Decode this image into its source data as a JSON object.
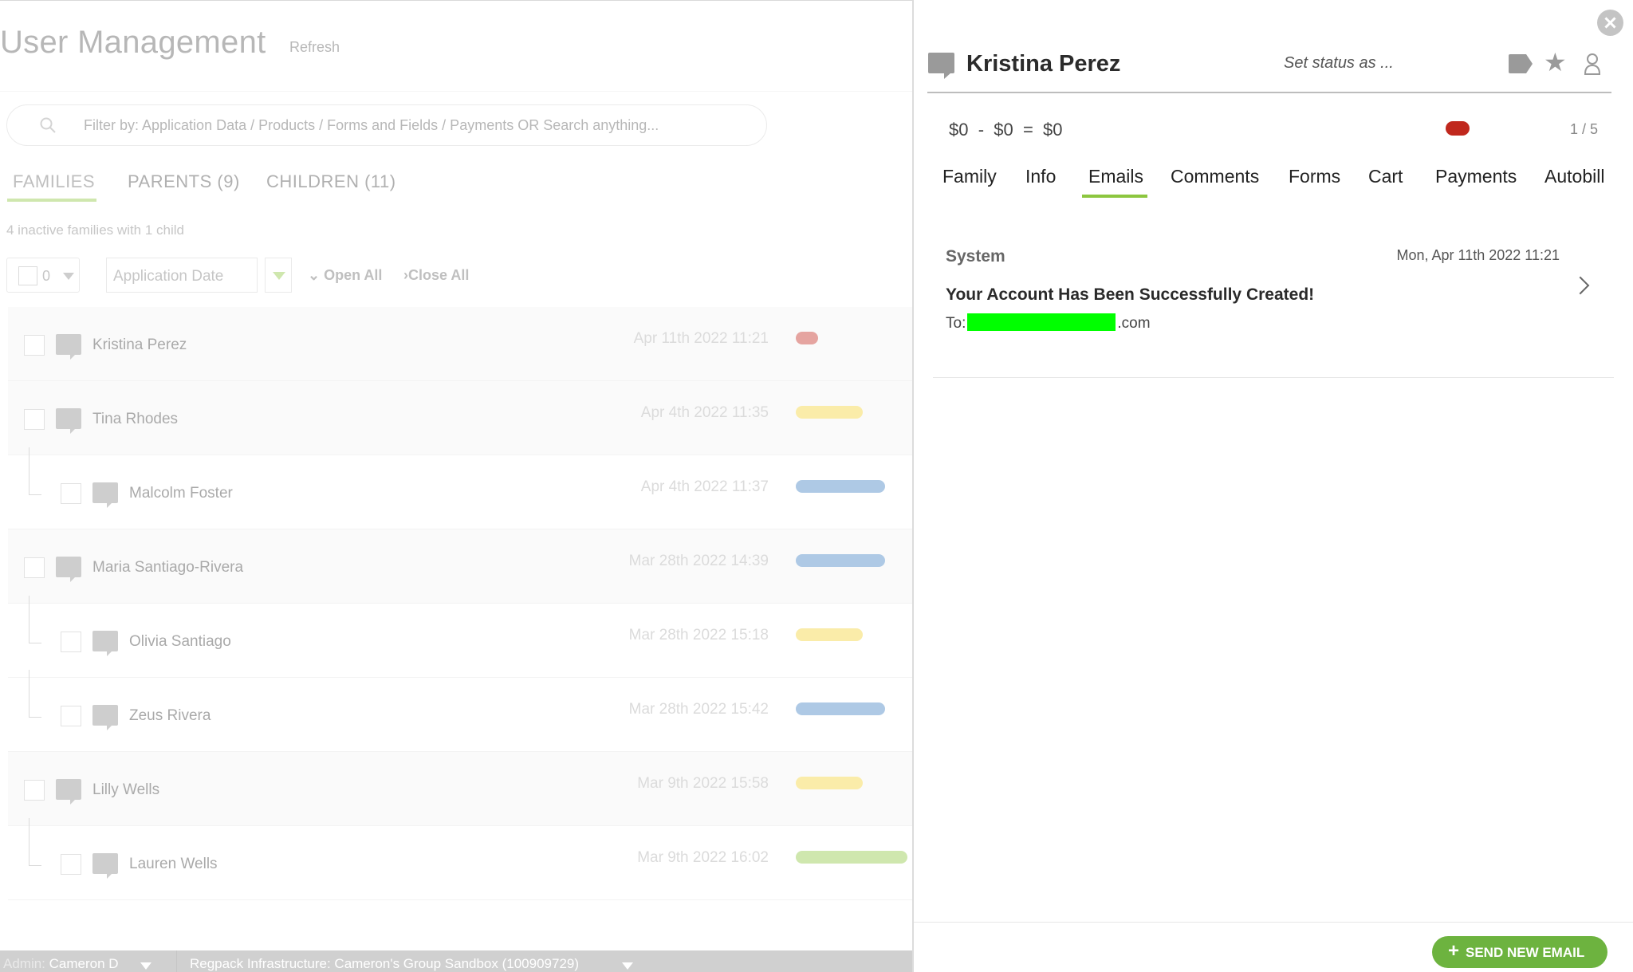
{
  "left": {
    "title": "User Management",
    "refresh": "Refresh",
    "search_placeholder": "Filter by: Application Data / Products / Forms and Fields / Payments OR Search anything...",
    "tabs": [
      {
        "label": "FAMILIES",
        "active": true
      },
      {
        "label": "PARENTS (9)",
        "active": false
      },
      {
        "label": "CHILDREN (11)",
        "active": false
      }
    ],
    "inactive_note": "4 inactive families with 1 child",
    "toolbar": {
      "selected_count": "0",
      "sort_by": "Application Date",
      "open_all": "Open All",
      "close_all": "Close All"
    },
    "rows": [
      {
        "name": "Kristina Perez",
        "date": "Apr 11th 2022 11:21",
        "child": false,
        "pill_color": "#c0281d"
      },
      {
        "name": "Tina Rhodes",
        "date": "Apr 4th 2022 11:35",
        "child": false,
        "pill_color": "#f2d233"
      },
      {
        "name": "Malcolm Foster",
        "date": "Apr 4th 2022 11:37",
        "child": true,
        "pill_color": "#3f7fc0"
      },
      {
        "name": "Maria Santiago-Rivera",
        "date": "Mar 28th 2022 14:39",
        "child": false,
        "pill_color": "#3f7fc0"
      },
      {
        "name": "Olivia Santiago",
        "date": "Mar 28th 2022 15:18",
        "child": true,
        "pill_color": "#f2d233"
      },
      {
        "name": "Zeus Rivera",
        "date": "Mar 28th 2022 15:42",
        "child": true,
        "pill_color": "#3f7fc0"
      },
      {
        "name": "Lilly Wells",
        "date": "Mar 9th 2022 15:58",
        "child": false,
        "pill_color": "#f2d233"
      },
      {
        "name": "Lauren Wells",
        "date": "Mar 9th 2022 16:02",
        "child": true,
        "pill_color": "#8cc63f"
      }
    ],
    "statusbar": {
      "admin_label": "Admin:",
      "admin_name": "Cameron D",
      "org": "Regpack Infrastructure: Cameron's Group Sandbox (100909729)"
    }
  },
  "panel": {
    "name": "Kristina Perez",
    "set_status": "Set status as ...",
    "balance": "$0  -  $0  =  $0",
    "status_color": "#c0281d",
    "pager": "1 / 5",
    "tabs": [
      {
        "label": "Family",
        "active": false
      },
      {
        "label": "Info",
        "active": false
      },
      {
        "label": "Emails",
        "active": true
      },
      {
        "label": "Comments",
        "active": false
      },
      {
        "label": "Forms",
        "active": false
      },
      {
        "label": "Cart",
        "active": false
      },
      {
        "label": "Payments",
        "active": false
      },
      {
        "label": "Autobill",
        "active": false
      }
    ],
    "emails": [
      {
        "from": "System",
        "date": "Mon, Apr 11th 2022 11:21",
        "subject": "Your Account Has Been Successfully Created!",
        "to_prefix": "To:",
        "to_suffix": ".com"
      }
    ],
    "send_button": "SEND NEW EMAIL"
  }
}
